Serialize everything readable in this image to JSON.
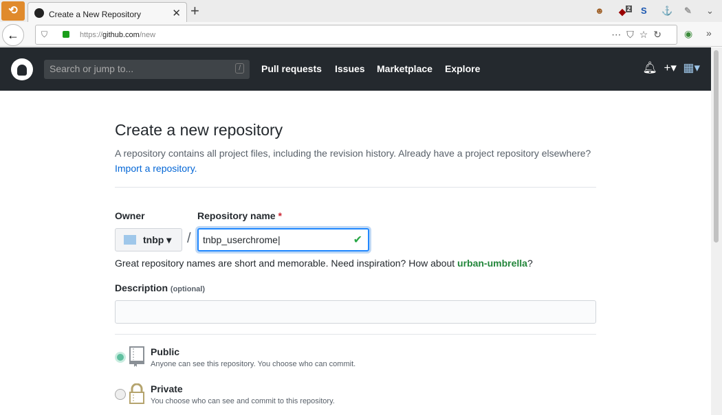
{
  "browser": {
    "tab_title": "Create a New Repository",
    "url_prefix": "https://",
    "url_host": "github.com",
    "url_path": "/new",
    "ext_badge": "2"
  },
  "header": {
    "search_placeholder": "Search or jump to...",
    "search_key": "/",
    "nav": [
      "Pull requests",
      "Issues",
      "Marketplace",
      "Explore"
    ]
  },
  "page": {
    "title": "Create a new repository",
    "subtitle": "A repository contains all project files, including the revision history. Already have a project repository elsewhere?",
    "import_link": "Import a repository.",
    "owner_label": "Owner",
    "owner_value": "tnbp",
    "repo_label": "Repository name",
    "required_mark": "*",
    "repo_value": "tnbp_userchrome",
    "hint_prefix": "Great repository names are short and memorable. Need inspiration? How about",
    "hint_name": "urban-umbrella",
    "hint_suffix": "?",
    "description_label": "Description",
    "description_optional": "(optional)",
    "description_value": "",
    "visibility": [
      {
        "title": "Public",
        "desc": "Anyone can see this repository. You choose who can commit.",
        "selected": true
      },
      {
        "title": "Private",
        "desc": "You choose who can see and commit to this repository.",
        "selected": false
      }
    ]
  }
}
